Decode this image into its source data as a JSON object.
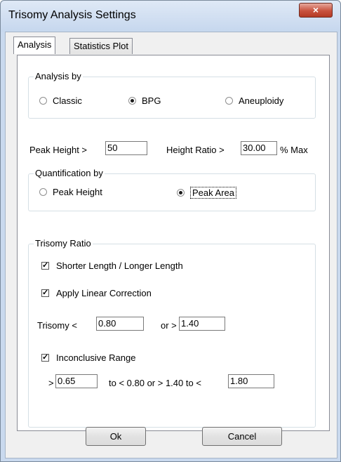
{
  "window": {
    "title": "Trisomy Analysis Settings",
    "close_glyph": "×"
  },
  "tabs": [
    {
      "label": "Analysis",
      "active": true
    },
    {
      "label": "Statistics Plot",
      "active": false
    }
  ],
  "analysis_by": {
    "legend": "Analysis by",
    "options": [
      {
        "label": "Classic",
        "checked": false
      },
      {
        "label": "BPG",
        "checked": true
      },
      {
        "label": "Aneuploidy",
        "checked": false
      }
    ]
  },
  "peak_height": {
    "label": "Peak Height >",
    "value": "50"
  },
  "height_ratio": {
    "label": "Height Ratio >",
    "value": "30.00",
    "unit": "% Max"
  },
  "quantification_by": {
    "legend": "Quantification by",
    "options": [
      {
        "label": "Peak Height",
        "checked": false
      },
      {
        "label": "Peak Area",
        "checked": true
      }
    ]
  },
  "trisomy_ratio": {
    "legend": "Trisomy Ratio",
    "shorter_longer": {
      "label": "Shorter Length / Longer Length",
      "checked": true
    },
    "linear_correction": {
      "label": "Apply Linear Correction",
      "checked": true
    },
    "trisomy_label": "Trisomy  <",
    "trisomy_low": "0.80",
    "or_label": "or >",
    "trisomy_high": "1.40",
    "inconclusive": {
      "label": "Inconclusive Range",
      "checked": true
    },
    "range_prefix": ">",
    "range_low": "0.65",
    "range_middle": "to < 0.80  or  > 1.40 to <",
    "range_high": "1.80"
  },
  "buttons": {
    "ok": "Ok",
    "cancel": "Cancel"
  },
  "colors": {
    "frame": "#c9d9ee",
    "close_button": "#c8523e",
    "panel": "#ffffff",
    "dialog_face": "#f0f0f0"
  }
}
